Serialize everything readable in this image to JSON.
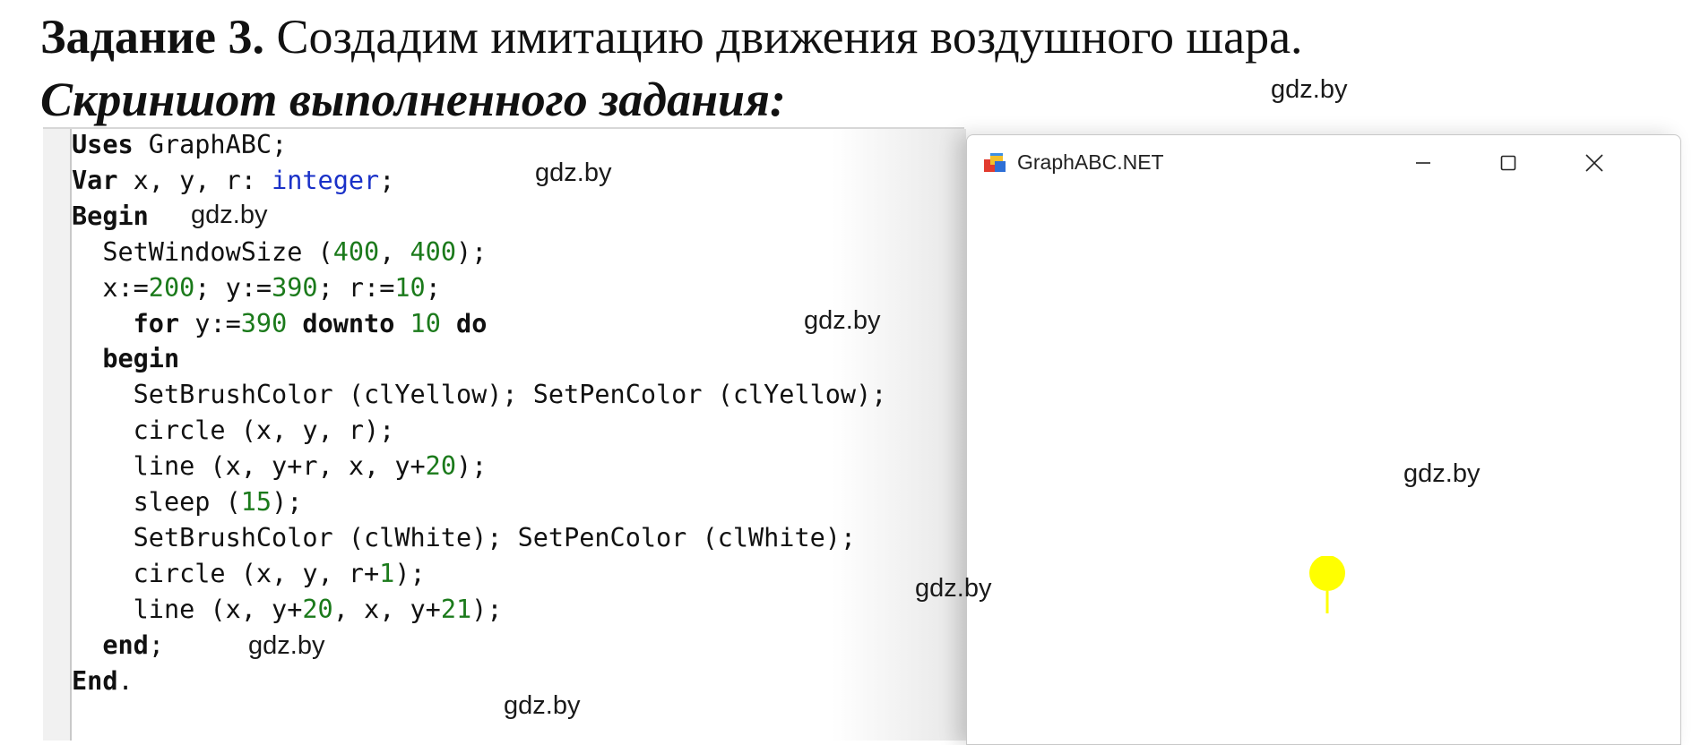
{
  "heading": {
    "task_bold": "Задание 3.",
    "task_text": " Создадим имитацию движения воздушного шара.",
    "subtitle": "Скриншот выполненного задания:"
  },
  "watermark": "gdz.by",
  "code": {
    "lines": [
      [
        {
          "t": "Uses",
          "c": "kw"
        },
        {
          "t": " GraphABC;"
        }
      ],
      [
        {
          "t": "Var",
          "c": "kw"
        },
        {
          "t": " x, y, r: "
        },
        {
          "t": "integer",
          "c": "ty"
        },
        {
          "t": ";"
        }
      ],
      [
        {
          "t": "Begin",
          "c": "kw"
        }
      ],
      [
        {
          "t": "  SetWindowSize ("
        },
        {
          "t": "400",
          "c": "num"
        },
        {
          "t": ", "
        },
        {
          "t": "400",
          "c": "num"
        },
        {
          "t": ");"
        }
      ],
      [
        {
          "t": "  x:="
        },
        {
          "t": "200",
          "c": "num"
        },
        {
          "t": "; y:="
        },
        {
          "t": "390",
          "c": "num"
        },
        {
          "t": "; r:="
        },
        {
          "t": "10",
          "c": "num"
        },
        {
          "t": ";"
        }
      ],
      [
        {
          "t": "    "
        },
        {
          "t": "for",
          "c": "kw"
        },
        {
          "t": " y:="
        },
        {
          "t": "390",
          "c": "num"
        },
        {
          "t": " "
        },
        {
          "t": "downto",
          "c": "kw"
        },
        {
          "t": " "
        },
        {
          "t": "10",
          "c": "num"
        },
        {
          "t": " "
        },
        {
          "t": "do",
          "c": "kw"
        }
      ],
      [
        {
          "t": "  "
        },
        {
          "t": "begin",
          "c": "kw"
        }
      ],
      [
        {
          "t": "    SetBrushColor (clYellow); SetPenColor (clYellow);"
        }
      ],
      [
        {
          "t": "    circle (x, y, r);"
        }
      ],
      [
        {
          "t": "    line (x, y+r, x, y+"
        },
        {
          "t": "20",
          "c": "num"
        },
        {
          "t": ");"
        }
      ],
      [
        {
          "t": "    sleep ("
        },
        {
          "t": "15",
          "c": "num"
        },
        {
          "t": ");"
        }
      ],
      [
        {
          "t": "    SetBrushColor (clWhite); SetPenColor (clWhite);"
        }
      ],
      [
        {
          "t": "    circle (x, y, r+"
        },
        {
          "t": "1",
          "c": "num"
        },
        {
          "t": ");"
        }
      ],
      [
        {
          "t": "    line (x, y+"
        },
        {
          "t": "20",
          "c": "num"
        },
        {
          "t": ", x, y+"
        },
        {
          "t": "21",
          "c": "num"
        },
        {
          "t": ");"
        }
      ],
      [
        {
          "t": "  "
        },
        {
          "t": "end",
          "c": "kw"
        },
        {
          "t": ";"
        }
      ],
      [
        {
          "t": "End",
          "c": "kw"
        },
        {
          "t": "."
        }
      ]
    ]
  },
  "window": {
    "title": "GraphABC.NET",
    "icons": [
      "app-icon",
      "minimize-icon",
      "maximize-icon",
      "close-icon"
    ]
  },
  "colors": {
    "keyword_type": "#1a31c8",
    "number": "#1b7a1b",
    "balloon": "#ffff00"
  }
}
